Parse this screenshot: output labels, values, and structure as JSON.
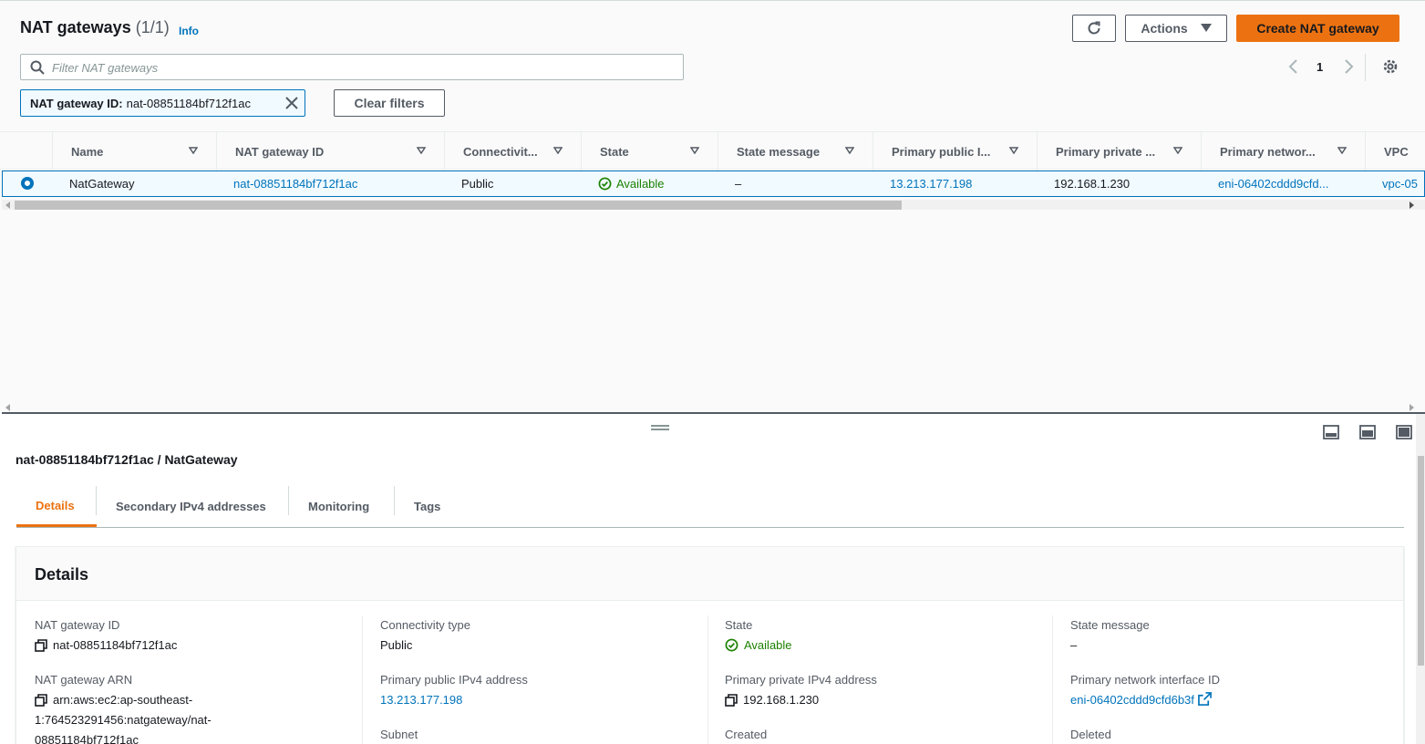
{
  "header": {
    "title": "NAT gateways",
    "count": "(1/1)",
    "info": "Info"
  },
  "toolbar": {
    "actions_label": "Actions",
    "create_label": "Create NAT gateway"
  },
  "search": {
    "placeholder": "Filter NAT gateways"
  },
  "pagination": {
    "page": "1"
  },
  "filter": {
    "key": "NAT gateway ID:",
    "value": "nat-08851184bf712f1ac",
    "clear_label": "Clear filters"
  },
  "table": {
    "columns": [
      "Name",
      "NAT gateway ID",
      "Connectivit...",
      "State",
      "State message",
      "Primary public I...",
      "Primary private ...",
      "Primary networ...",
      "VPC"
    ],
    "row": {
      "name": "NatGateway",
      "id": "nat-08851184bf712f1ac",
      "connectivity": "Public",
      "state": "Available",
      "state_message": "–",
      "public_ip": "13.213.177.198",
      "private_ip": "192.168.1.230",
      "eni": "eni-06402cddd9cfd...",
      "vpc": "vpc-05"
    }
  },
  "detail": {
    "title": "nat-08851184bf712f1ac / NatGateway",
    "tabs": [
      "Details",
      "Secondary IPv4 addresses",
      "Monitoring",
      "Tags"
    ],
    "section_heading": "Details",
    "fields": {
      "id_label": "NAT gateway ID",
      "id_value": "nat-08851184bf712f1ac",
      "connectivity_label": "Connectivity type",
      "connectivity_value": "Public",
      "state_label": "State",
      "state_value": "Available",
      "state_message_label": "State message",
      "state_message_value": "–",
      "arn_label": "NAT gateway ARN",
      "arn_line1": "arn:aws:ec2:ap-southeast-",
      "arn_line2": "1:764523291456:natgateway/nat-",
      "arn_line3": "08851184bf712f1ac",
      "public_ip_label": "Primary public IPv4 address",
      "public_ip_value": "13.213.177.198",
      "private_ip_label": "Primary private IPv4 address",
      "private_ip_value": "192.168.1.230",
      "eni_label": "Primary network interface ID",
      "eni_value": "eni-06402cddd9cfd6b3f",
      "subnet_label": "Subnet",
      "created_label": "Created",
      "deleted_label": "Deleted"
    }
  },
  "colors": {
    "accent": "#ec7211",
    "link": "#0073bb",
    "success": "#1d8102"
  }
}
